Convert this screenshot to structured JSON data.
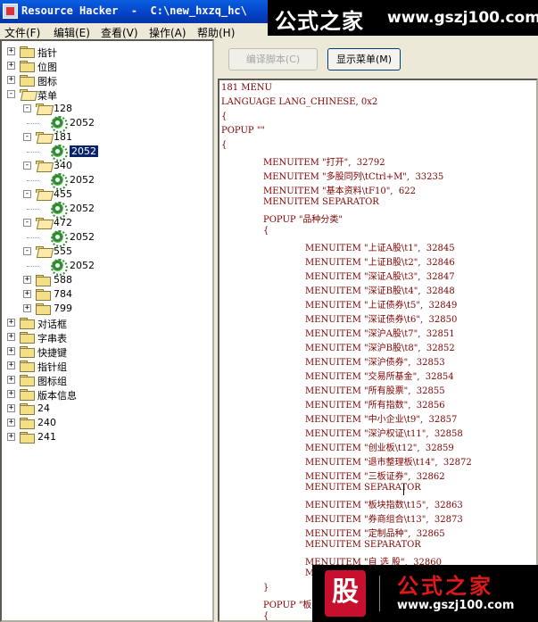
{
  "window": {
    "title": "Resource Hacker  -  C:\\new_hxzq_hc\\"
  },
  "watermark_top": {
    "chinese": "公式之家",
    "url": "www.gszj100.com"
  },
  "watermark_bottom": {
    "logo": "股",
    "chinese": "公式之家",
    "url": "www.gszj100.com"
  },
  "menu": {
    "file": "文件(F)",
    "edit": "编辑(E)",
    "view": "查看(V)",
    "action": "操作(A)",
    "help": "帮助(H)"
  },
  "toolbar": {
    "compile_label": "编译脚本(C)",
    "show_menu_label": "显示菜单(M)"
  },
  "tree": [
    {
      "label": "指针",
      "level": 0,
      "exp": "+",
      "icon": "folder"
    },
    {
      "label": "位图",
      "level": 0,
      "exp": "+",
      "icon": "folder"
    },
    {
      "label": "图标",
      "level": 0,
      "exp": "+",
      "icon": "folder"
    },
    {
      "label": "菜单",
      "level": 0,
      "exp": "-",
      "icon": "folder-open"
    },
    {
      "label": "128",
      "level": 1,
      "exp": "-",
      "icon": "folder-open"
    },
    {
      "label": "2052",
      "level": 2,
      "exp": "",
      "icon": "gear"
    },
    {
      "label": "181",
      "level": 1,
      "exp": "-",
      "icon": "folder-open"
    },
    {
      "label": "2052",
      "level": 2,
      "exp": "",
      "icon": "gear",
      "selected": true
    },
    {
      "label": "340",
      "level": 1,
      "exp": "-",
      "icon": "folder-open"
    },
    {
      "label": "2052",
      "level": 2,
      "exp": "",
      "icon": "gear"
    },
    {
      "label": "455",
      "level": 1,
      "exp": "-",
      "icon": "folder-open"
    },
    {
      "label": "2052",
      "level": 2,
      "exp": "",
      "icon": "gear"
    },
    {
      "label": "472",
      "level": 1,
      "exp": "-",
      "icon": "folder-open"
    },
    {
      "label": "2052",
      "level": 2,
      "exp": "",
      "icon": "gear"
    },
    {
      "label": "555",
      "level": 1,
      "exp": "-",
      "icon": "folder-open"
    },
    {
      "label": "2052",
      "level": 2,
      "exp": "",
      "icon": "gear"
    },
    {
      "label": "588",
      "level": 1,
      "exp": "+",
      "icon": "folder"
    },
    {
      "label": "784",
      "level": 1,
      "exp": "+",
      "icon": "folder"
    },
    {
      "label": "799",
      "level": 1,
      "exp": "+",
      "icon": "folder"
    },
    {
      "label": "对话框",
      "level": 0,
      "exp": "+",
      "icon": "folder"
    },
    {
      "label": "字串表",
      "level": 0,
      "exp": "+",
      "icon": "folder"
    },
    {
      "label": "快捷键",
      "level": 0,
      "exp": "+",
      "icon": "folder"
    },
    {
      "label": "指针组",
      "level": 0,
      "exp": "+",
      "icon": "folder"
    },
    {
      "label": "图标组",
      "level": 0,
      "exp": "+",
      "icon": "folder"
    },
    {
      "label": "版本信息",
      "level": 0,
      "exp": "+",
      "icon": "folder"
    },
    {
      "label": "24",
      "level": 0,
      "exp": "+",
      "icon": "folder"
    },
    {
      "label": "240",
      "level": 0,
      "exp": "+",
      "icon": "folder"
    },
    {
      "label": "241",
      "level": 0,
      "exp": "+",
      "icon": "folder"
    }
  ],
  "code": [
    {
      "text": "181 MENU",
      "indent": 0
    },
    {
      "text": "LANGUAGE LANG_CHINESE, 0x2",
      "indent": 0
    },
    {
      "text": "{",
      "indent": 0
    },
    {
      "text": "POPUP \"\"",
      "indent": 0
    },
    {
      "text": "{",
      "indent": 0
    },
    {
      "text": "MENUITEM \"打开\",  32792",
      "indent": 1
    },
    {
      "text": "MENUITEM \"多股同列\\tCtrl+M\",  33235",
      "indent": 1
    },
    {
      "text": "MENUITEM \"基本资料\\tF10\",  622",
      "indent": 1
    },
    {
      "text": "MENUITEM SEPARATOR",
      "indent": 1
    },
    {
      "text": "POPUP \"品种分类\"",
      "indent": 1
    },
    {
      "text": "{",
      "indent": 1
    },
    {
      "text": "MENUITEM \"上证A股\\t1\",  32845",
      "indent": 2
    },
    {
      "text": "MENUITEM \"上证B股\\t2\",  32846",
      "indent": 2
    },
    {
      "text": "MENUITEM \"深证A股\\t3\",  32847",
      "indent": 2
    },
    {
      "text": "MENUITEM \"深证B股\\t4\",  32848",
      "indent": 2
    },
    {
      "text": "MENUITEM \"上证债券\\t5\",  32849",
      "indent": 2
    },
    {
      "text": "MENUITEM \"深证债券\\t6\",  32850",
      "indent": 2
    },
    {
      "text": "MENUITEM \"深沪A股\\t7\",  32851",
      "indent": 2
    },
    {
      "text": "MENUITEM \"深沪B股\\t8\",  32852",
      "indent": 2
    },
    {
      "text": "MENUITEM \"深沪债券\",  32853",
      "indent": 2
    },
    {
      "text": "MENUITEM \"交易所基金\",  32854",
      "indent": 2
    },
    {
      "text": "MENUITEM \"所有股票\",  32855",
      "indent": 2
    },
    {
      "text": "MENUITEM \"所有指数\",  32856",
      "indent": 2
    },
    {
      "text": "MENUITEM \"中小企业\\t9\",  32857",
      "indent": 2
    },
    {
      "text": "MENUITEM \"深沪权证\\t11\",  32858",
      "indent": 2
    },
    {
      "text": "MENUITEM \"创业板\\t12\",  32859",
      "indent": 2
    },
    {
      "text": "MENUITEM \"退市整理板\\t14\",  32872",
      "indent": 2
    },
    {
      "text": "MENUITEM \"三板证券\",  32862",
      "indent": 2
    },
    {
      "text": "MENUITEM SEPARATOR",
      "indent": 2
    },
    {
      "text": "MENUITEM \"板块指数\\t15\",  32863",
      "indent": 2
    },
    {
      "text": "MENUITEM \"券商组合\\t13\",  32873",
      "indent": 2
    },
    {
      "text": "MENUITEM \"定制品种\",  32865",
      "indent": 2
    },
    {
      "text": "MENUITEM SEPARATOR",
      "indent": 2
    },
    {
      "text": "MENUITEM \"自 选 股\",  32860",
      "indent": 2
    },
    {
      "text": "MEN",
      "indent": 2
    },
    {
      "text": "}",
      "indent": 1
    },
    {
      "text": "POPUP \"板块",
      "indent": 1
    },
    {
      "text": "{",
      "indent": 1
    }
  ]
}
